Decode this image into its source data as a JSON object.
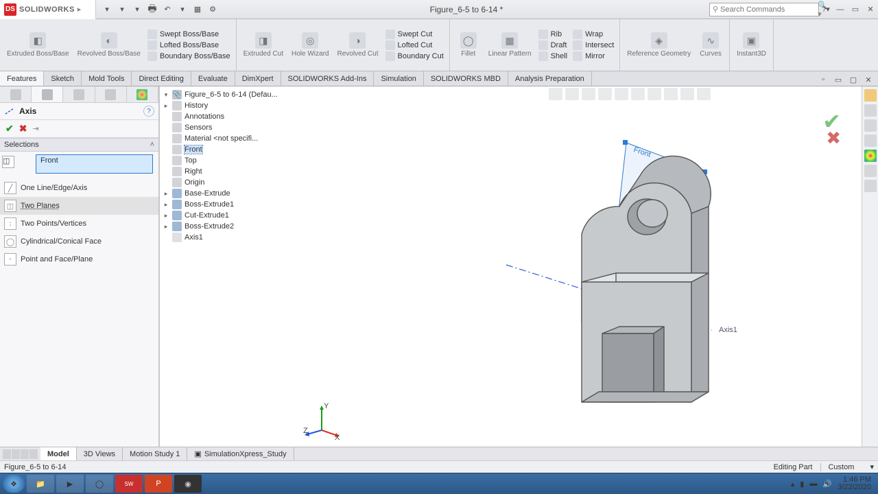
{
  "app": {
    "name": "SOLIDWORKS",
    "title": "Figure_6-5 to 6-14 *"
  },
  "search": {
    "placeholder": "Search Commands"
  },
  "ribbon": {
    "extruded_boss": "Extruded Boss/Base",
    "revolved_boss": "Revolved Boss/Base",
    "swept_boss": "Swept Boss/Base",
    "lofted_boss": "Lofted Boss/Base",
    "boundary_boss": "Boundary Boss/Base",
    "extruded_cut": "Extruded Cut",
    "hole_wizard": "Hole Wizard",
    "revolved_cut": "Revolved Cut",
    "swept_cut": "Swept Cut",
    "lofted_cut": "Lofted Cut",
    "boundary_cut": "Boundary Cut",
    "fillet": "Fillet",
    "linear_pattern": "Linear Pattern",
    "rib": "Rib",
    "draft": "Draft",
    "shell": "Shell",
    "wrap": "Wrap",
    "intersect": "Intersect",
    "mirror": "Mirror",
    "ref_geom": "Reference Geometry",
    "curves": "Curves",
    "instant3d": "Instant3D"
  },
  "tabs": [
    "Features",
    "Sketch",
    "Mold Tools",
    "Direct Editing",
    "Evaluate",
    "DimXpert",
    "SOLIDWORKS Add-Ins",
    "Simulation",
    "SOLIDWORKS MBD",
    "Analysis Preparation"
  ],
  "pm": {
    "title": "Axis",
    "section": "Selections",
    "selection": "Front",
    "opts": [
      "One Line/Edge/Axis",
      "Two Planes",
      "Two Points/Vertices",
      "Cylindrical/Conical Face",
      "Point and Face/Plane"
    ]
  },
  "tree": {
    "root": "Figure_6-5 to 6-14  (Defau...",
    "items": [
      "History",
      "Annotations",
      "Sensors",
      "Material <not specifi...",
      "Front",
      "Top",
      "Right",
      "Origin",
      "Base-Extrude",
      "Boss-Extrude1",
      "Cut-Extrude1",
      "Boss-Extrude2",
      "Axis1"
    ]
  },
  "viewport": {
    "plane_label": "Front",
    "axis_label": "Axis1",
    "triad": {
      "x": "X",
      "y": "Y",
      "z": "Z"
    }
  },
  "bottom_tabs": [
    "Model",
    "3D Views",
    "Motion Study 1",
    "SimulationXpress_Study"
  ],
  "status": {
    "left": "Figure_6-5 to 6-14",
    "editing": "Editing Part",
    "custom": "Custom"
  },
  "taskbar": {
    "time": "1:46 PM",
    "date": "3/22/2020"
  }
}
